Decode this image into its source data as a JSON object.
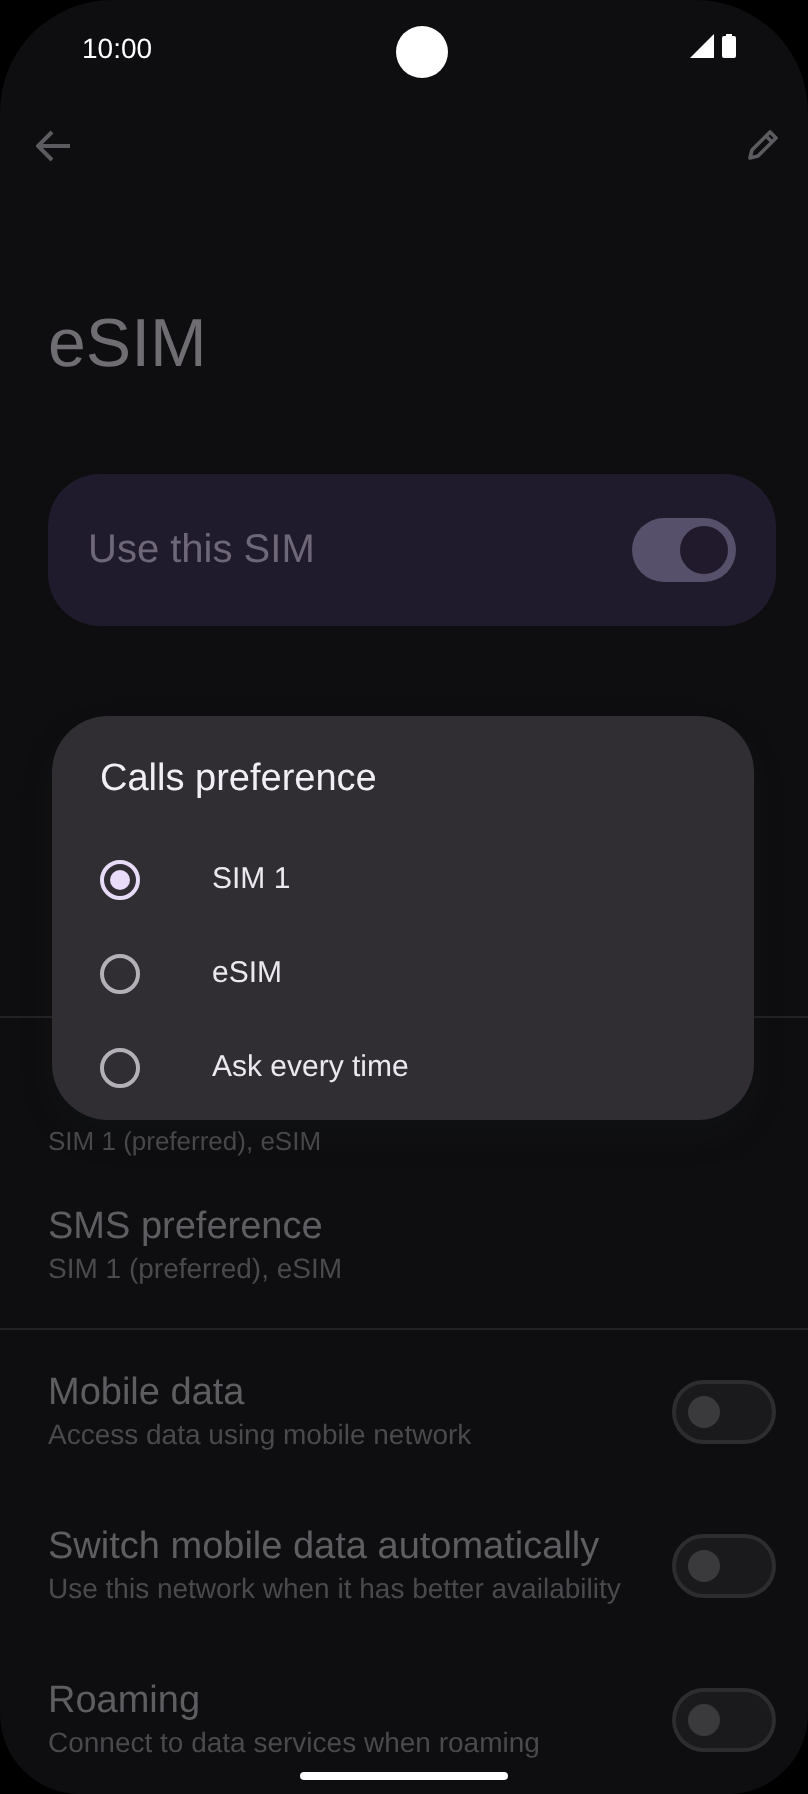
{
  "status_bar": {
    "time": "10:00"
  },
  "title": "eSIM",
  "use_sim": {
    "label": "Use this SIM",
    "on": true
  },
  "calls_row": {
    "subtitle": "SIM 1 (preferred), eSIM"
  },
  "settings": [
    {
      "kind": "pref",
      "title": "SMS preference",
      "subtitle": "SIM 1 (preferred), eSIM"
    },
    {
      "kind": "toggle",
      "title": "Mobile data",
      "subtitle": "Access data using mobile network",
      "on": false
    },
    {
      "kind": "toggle",
      "title": "Switch mobile data automatically",
      "subtitle": "Use this network when it has better availability",
      "on": false
    },
    {
      "kind": "toggle",
      "title": "Roaming",
      "subtitle": "Connect to data services when roaming",
      "on": false
    }
  ],
  "dialog": {
    "title": "Calls preference",
    "options": [
      {
        "label": "SIM 1",
        "selected": true
      },
      {
        "label": "eSIM",
        "selected": false
      },
      {
        "label": "Ask every time",
        "selected": false
      }
    ]
  }
}
